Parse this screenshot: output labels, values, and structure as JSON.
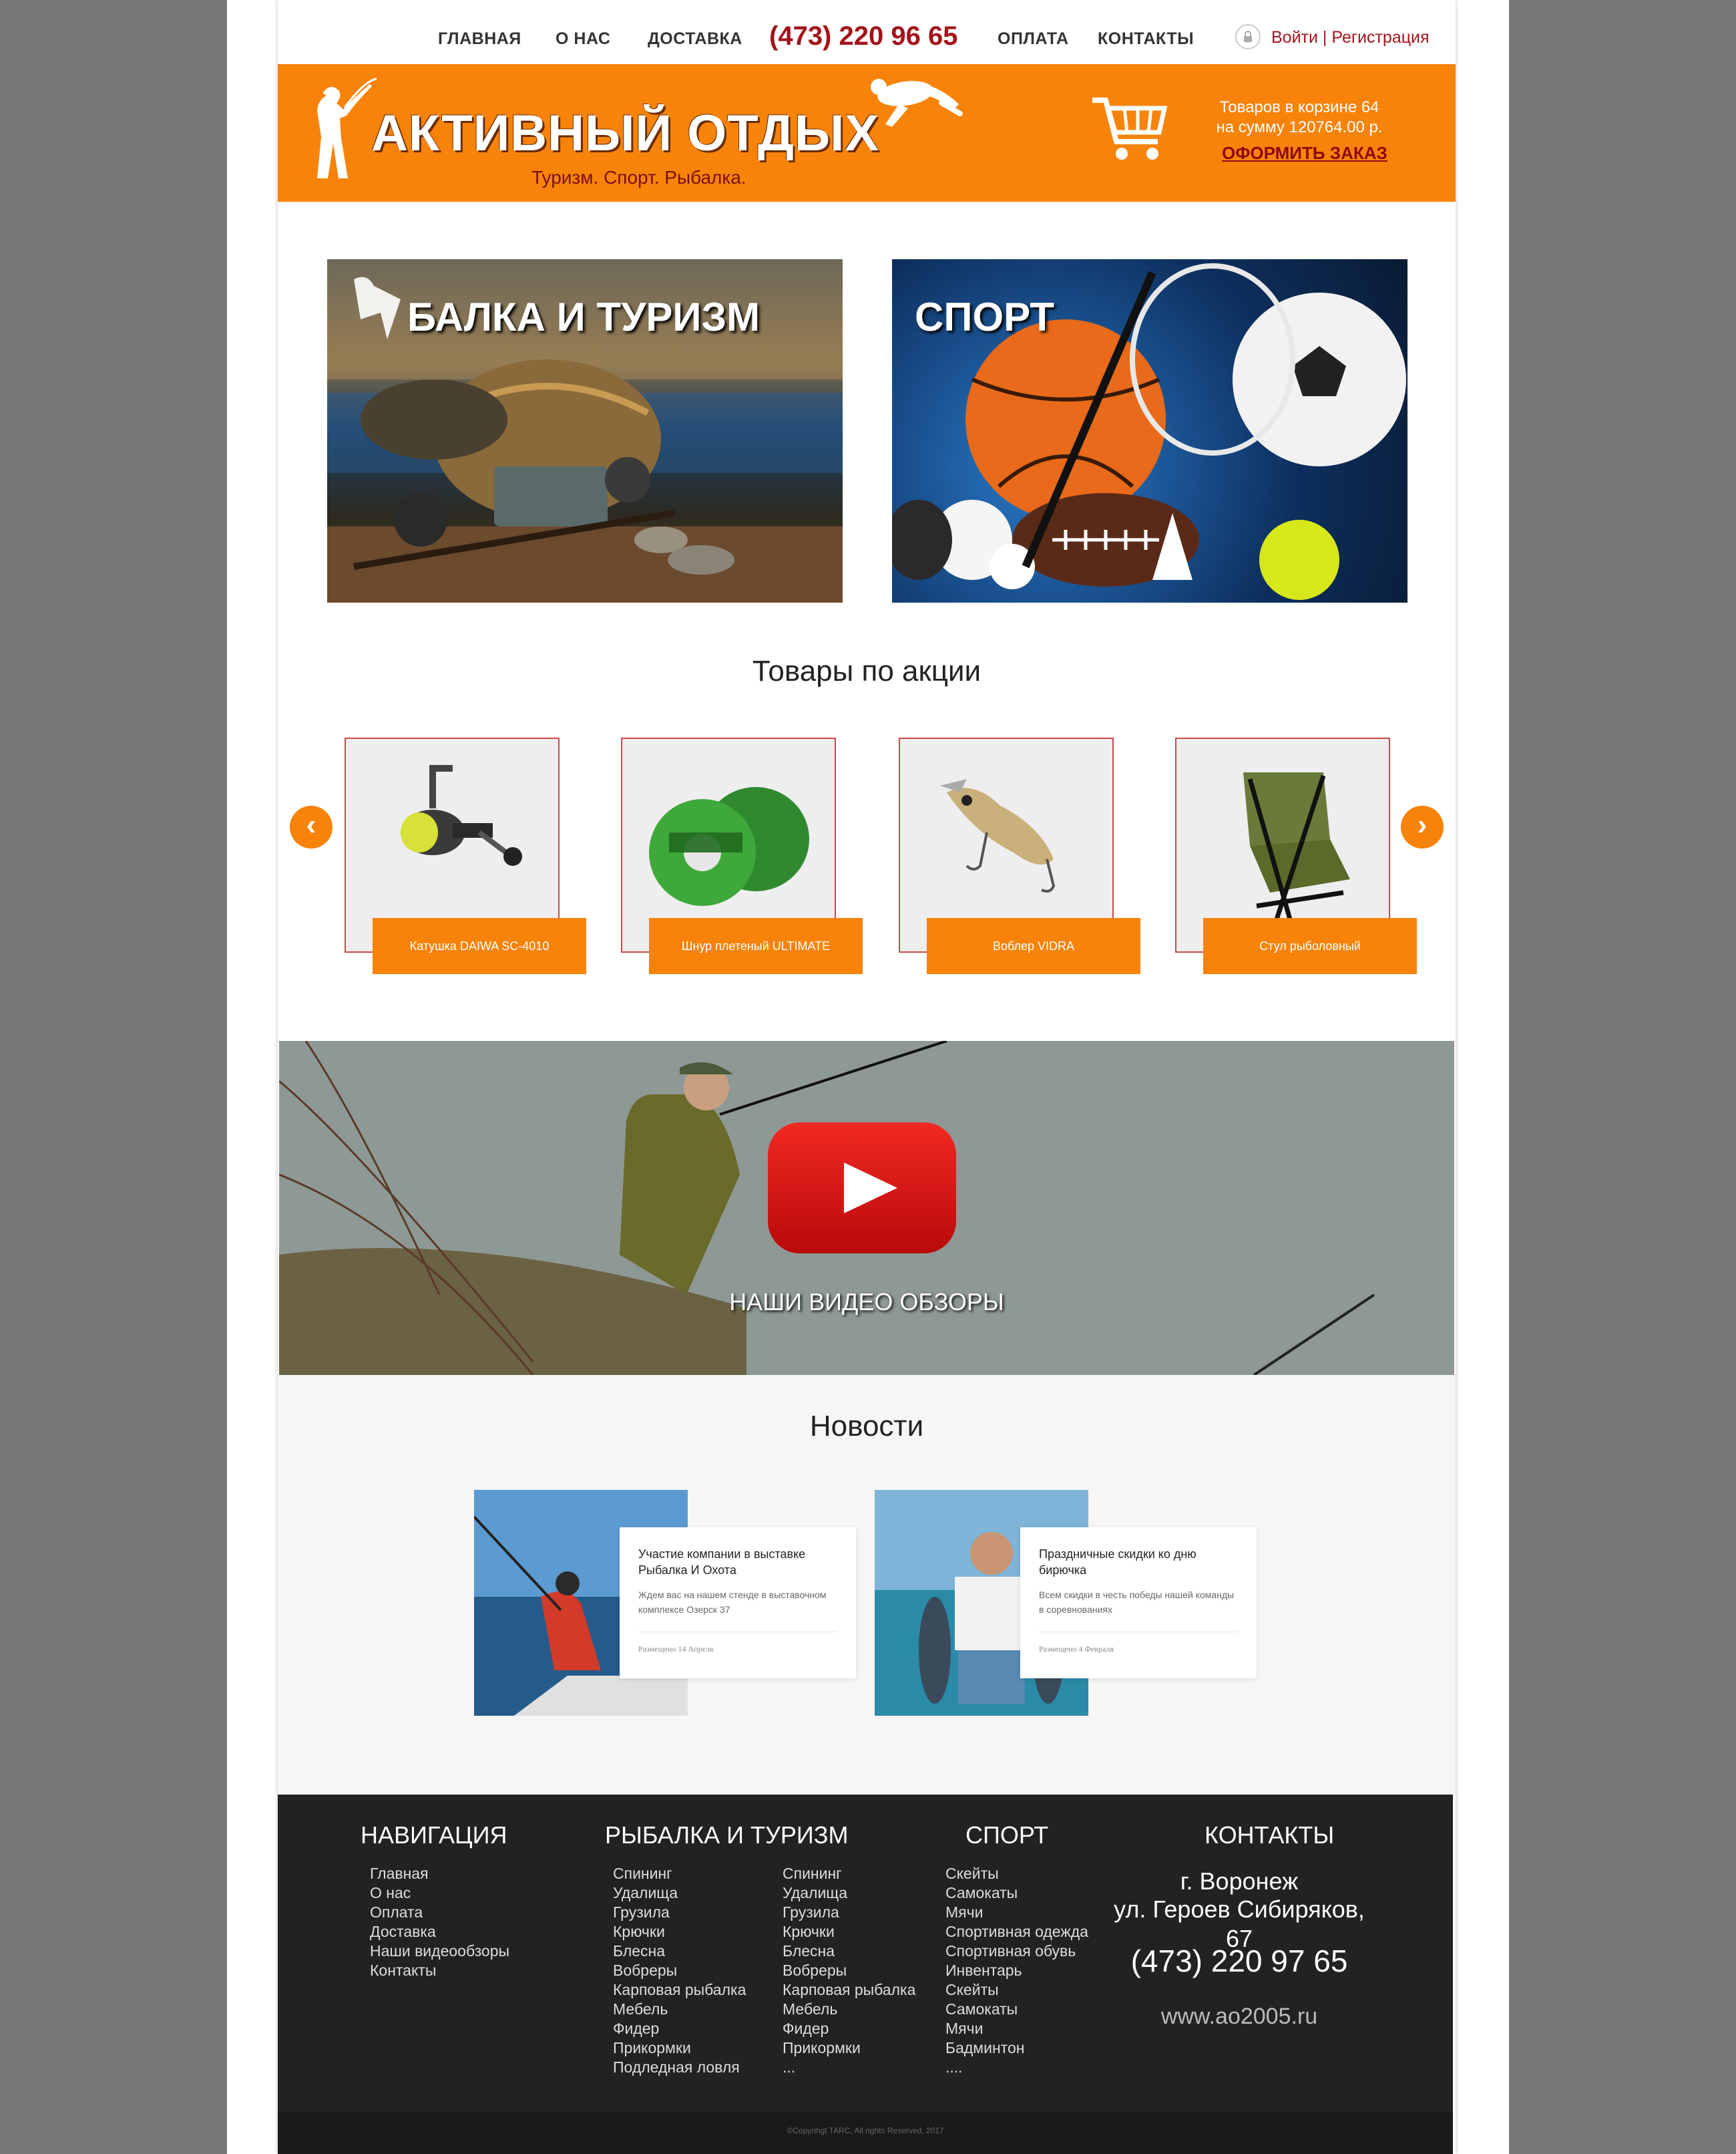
{
  "nav": {
    "home": "ГЛАВНАЯ",
    "about": "О НАС",
    "delivery": "ДОСТАВКА",
    "phone": "(473) 220 96 65",
    "payment": "ОПЛАТА",
    "contacts": "КОНТАКТЫ",
    "login": "Войти",
    "separator": "|",
    "register": "Регистрация",
    "lock_icon": "lock-icon"
  },
  "header": {
    "title": "АКТИВНЫЙ ОТДЫХ",
    "subtitle": "Туризм. Спорт. Рыбалка.",
    "cart_line1": "Товаров в корзине 64",
    "cart_line2": "на сумму  120764.00 р.",
    "order_label": "ОФОРМИТЬ ЗАКАЗ",
    "accent_color": "#f7830a"
  },
  "banners": [
    {
      "title": "БАЛКА И ТУРИЗМ"
    },
    {
      "title": "СПОРТ"
    }
  ],
  "promo": {
    "title": "Товары по акции",
    "products": [
      {
        "label": "Катушка DAIWA SC-4010"
      },
      {
        "label": "Шнур плетеный ULTIMATE"
      },
      {
        "label": "Воблер VIDRA"
      },
      {
        "label": "Стул рыболовный"
      }
    ],
    "prev_icon": "chevron-left-icon",
    "next_icon": "chevron-right-icon"
  },
  "video": {
    "title": "НАШИ ВИДЕО ОБЗОРЫ",
    "icon": "youtube-play-icon"
  },
  "news": {
    "title": "Новости",
    "items": [
      {
        "title": "Участие компании в выставке Рыбалка И Охота",
        "desc": "Ждем вас на нашем стенде в выставочном комплексе Озерск 37",
        "date": "Размещено 14 Апреля"
      },
      {
        "title": "Праздничные скидки ко дню бирючка",
        "desc": "Всем скидки в честь победы нашей команды в соревнованиях",
        "date": "Размещено 4 Февраля"
      }
    ]
  },
  "footer": {
    "nav_title": "НАВИГАЦИЯ",
    "nav_items": [
      "Главная",
      "О нас",
      "Оплата",
      "Доставка",
      "Наши видеообзоры",
      "Контакты"
    ],
    "fish_title": "РЫБАЛКА И ТУРИЗМ",
    "fish_col1": [
      "Спининг",
      "Удалища",
      "Грузила",
      "Крючки",
      "Блесна",
      "Вобреры",
      "Карповая рыбалка",
      "Мебель",
      "Фидер",
      "Прикормки",
      "Подледная ловля"
    ],
    "fish_col2": [
      "Спининг",
      "Удалища",
      "Грузила",
      "Крючки",
      "Блесна",
      "Вобреры",
      "Карповая рыбалка",
      "Мебель",
      "Фидер",
      "Прикормки",
      "..."
    ],
    "sport_title": "СПОРТ",
    "sport_items": [
      "Скейты",
      "Самокаты",
      "Мячи",
      "Спортивная одежда",
      "Спортивная обувь",
      "Инвентарь",
      "Скейты",
      "Самокаты",
      "Мячи",
      "Бадминтон",
      "...."
    ],
    "contacts_title": "КОНТАКТЫ",
    "city": "г. Воронеж",
    "address": "ул. Героев Сибиряков, 67",
    "phone": "(473) 220 97 65",
    "site": "www.ao2005.ru",
    "copyright": "©Copyrihgt TARC, All rights Reserved, 2017"
  }
}
